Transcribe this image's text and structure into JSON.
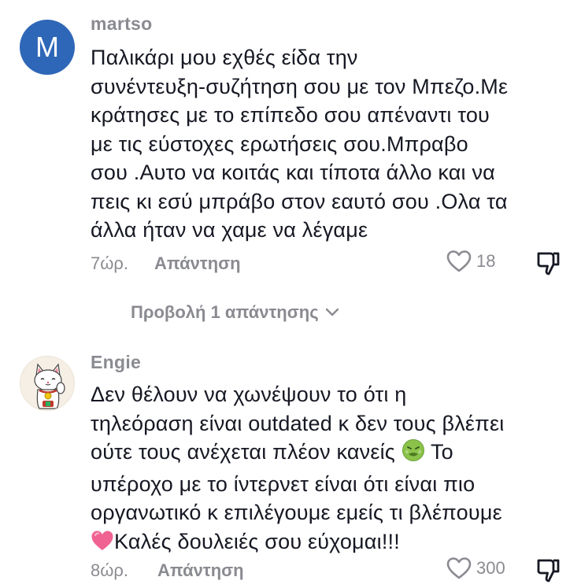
{
  "comments": [
    {
      "username": "martso",
      "avatar_letter": "M",
      "text": "Παλικάρι μου εχθές είδα την\nσυνέντευξη-συζήτηση σου με τον Μπεζο.Με\nκράτησες με το επίπεδο σου απέναντι του\nμε τις εύστοχες ερωτήσεις σου.Μπραβο\nσου .Αυτο να κοιτάς και τίποτα άλλο και να\nπεις κι εσύ μπράβο στον εαυτό σου .Ολα τα\nάλλα ήταν να χαμε να λέγαμε",
      "time": "7ώρ.",
      "reply_label": "Απάντηση",
      "likes": "18"
    },
    {
      "username": "Engie",
      "avatar_icon": "lucky-cat-icon",
      "text_lines": [
        "Δεν θέλουν να χωνέψουν το ότι η",
        "τηλεόραση είναι outdated κ δεν τους βλέπει",
        "ούτε τους ανέχεται πλέον κανείς",
        "Το",
        "υπέροχο με το ίντερνετ είναι ότι είναι πιο",
        "οργανωτικό κ επιλέγουμε εμείς τι βλέπουμε",
        "Καλές δουλειές σου εύχομαι!!!"
      ],
      "emojis": [
        "nauseated-face-icon",
        "pink-heart-icon"
      ],
      "time": "8ώρ.",
      "reply_label": "Απάντηση",
      "likes": "300"
    }
  ],
  "view_replies_label": "Προβολή 1 απάντησης",
  "colors": {
    "text": "#161823",
    "muted": "#8a8b91",
    "avatar_m": "#2f67b8"
  }
}
